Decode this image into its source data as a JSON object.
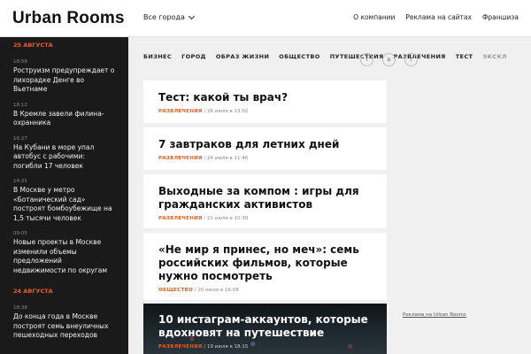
{
  "header": {
    "logo": "Urban Rooms",
    "city": "Все города",
    "nav": [
      "О компании",
      "Реклама на сайтах",
      "Франшиза"
    ]
  },
  "sidebar": {
    "groups": [
      {
        "date": "25 АВГУСТА",
        "items": [
          {
            "time": "18:58",
            "title": "Роструизм предупреждает о лихорадке Денге во Вьетнаме"
          },
          {
            "time": "18:12",
            "title": "В Кремле завели филина-охранника"
          },
          {
            "time": "16:27",
            "title": "На Кубани в море упал автобус с рабочими: погибли 17 человек"
          },
          {
            "time": "14:25",
            "title": "В Москве у метро «Ботанический сад» построят бомбоубежище на 1,5 тысячи человек"
          },
          {
            "time": "09:05",
            "title": "Новые проекты в Москве изменили объемы предложений недвижимости по округам"
          }
        ]
      },
      {
        "date": "24 АВГУСТА",
        "items": [
          {
            "time": "18:38",
            "title": "До конца года в Москве построят семь внеуличных пешеходных переходов"
          }
        ]
      }
    ]
  },
  "categories": [
    "БИЗНЕС",
    "ГОРОД",
    "ОБРАЗ ЖИЗНИ",
    "ОБЩЕСТВО",
    "ПУТЕШЕСТВИЯ",
    "РАЗВЛЕЧЕНИЯ",
    "ТЕСТ",
    "ЭКСКЛ"
  ],
  "social_icons": [
    "facebook-icon",
    "vk-icon",
    "twitter-icon"
  ],
  "articles": [
    {
      "title": "Тест: какой ты врач?",
      "category": "РАЗВЛЕЧЕНИЯ",
      "date": "/ 26 июля в 13:02"
    },
    {
      "title": "7 завтраков для летних дней",
      "category": "РАЗВЛЕЧЕНИЯ",
      "date": "/ 24 июля в 11:46"
    },
    {
      "title": "Выходные за компом : игры для гражданских активистов",
      "category": "РАЗВЛЕЧЕНИЯ",
      "date": "/ 21 июля в 10:30"
    },
    {
      "title": "«Не мир я принес, но меч»: семь российских фильмов, которые нужно посмотреть",
      "category": "ОБЩЕСТВО",
      "date": "/ 20 июля в 16:08"
    },
    {
      "title": "10 инстаграм-аккаунтов, которые вдохновят на путешествие",
      "category": "РАЗВЛЕЧЕНИЯ",
      "date": "/ 19 июля в 18:15"
    }
  ],
  "ad_link": "Реклама на Urban Rooms",
  "colors": {
    "accent": "#e85d1a",
    "sidebar_bg": "#1a1a1a",
    "page_bg": "#f0f0f0"
  }
}
